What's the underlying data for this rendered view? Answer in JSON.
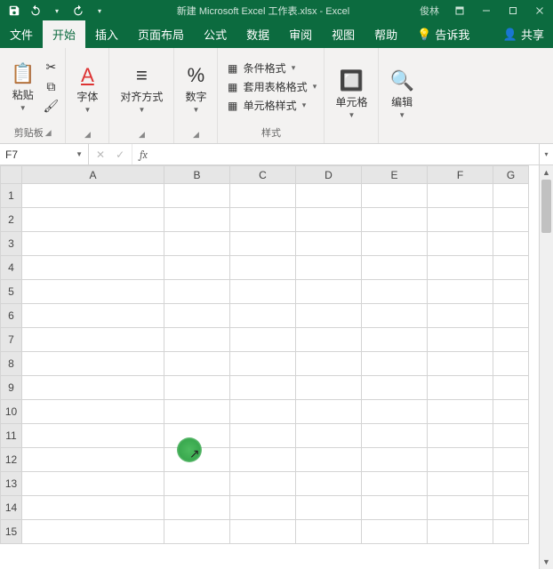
{
  "titlebar": {
    "doc": "新建 Microsoft Excel 工作表.xlsx",
    "app": "Excel",
    "user": "俊林",
    "sep": " - "
  },
  "tabs": {
    "file": "文件",
    "home": "开始",
    "insert": "插入",
    "layout": "页面布局",
    "formulas": "公式",
    "data": "数据",
    "review": "审阅",
    "view": "视图",
    "help": "帮助",
    "tellme": "告诉我",
    "share": "共享"
  },
  "ribbon": {
    "clipboard": {
      "paste": "粘贴",
      "label": "剪贴板"
    },
    "font": {
      "label": "字体"
    },
    "align": {
      "label": "对齐方式"
    },
    "number": {
      "label": "数字"
    },
    "styles": {
      "cond": "条件格式",
      "tablefmt": "套用表格格式",
      "cellstyle": "单元格样式",
      "label": "样式"
    },
    "cells": {
      "label": "单元格"
    },
    "editing": {
      "label": "编辑"
    }
  },
  "namebox": {
    "ref": "F7"
  },
  "formula_fx": "fx",
  "columns": [
    "A",
    "B",
    "C",
    "D",
    "E",
    "F",
    "G"
  ],
  "rows": [
    "1",
    "2",
    "3",
    "4",
    "5",
    "6",
    "7",
    "8",
    "9",
    "10",
    "11",
    "12",
    "13",
    "14",
    "15"
  ]
}
